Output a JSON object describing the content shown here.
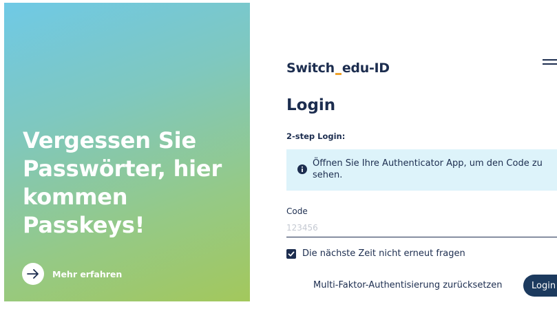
{
  "promo": {
    "heading": "Vergessen Sie Passwörter, hier kommen Passkeys!",
    "link_label": "Mehr erfahren",
    "link_icon": "arrow-right-icon"
  },
  "header": {
    "logo_part1": "Switch",
    "logo_part2": "edu-ID",
    "menu_icon": "hamburger-menu-icon"
  },
  "login": {
    "title": "Login",
    "step_label": "2-step Login:",
    "info_icon": "info-icon",
    "info_text": "Öffnen Sie Ihre Authenticator App, um den Code zu sehen.",
    "code_label": "Code",
    "code_value": "",
    "code_placeholder": "123456",
    "remember_checked": true,
    "remember_label": "Die nächste Zeit nicht erneut fragen",
    "reset_label": "Multi-Faktor-Authentisierung zurücksetzen",
    "login_button": "Login"
  },
  "colors": {
    "navy": "#1c2d4f",
    "logo_accent": "#f0a22a",
    "info_bg": "#ddf3fa",
    "button_bg": "#1c3a5e",
    "gradient_top": "#6fc9e6",
    "gradient_bottom": "#a3c85c"
  }
}
